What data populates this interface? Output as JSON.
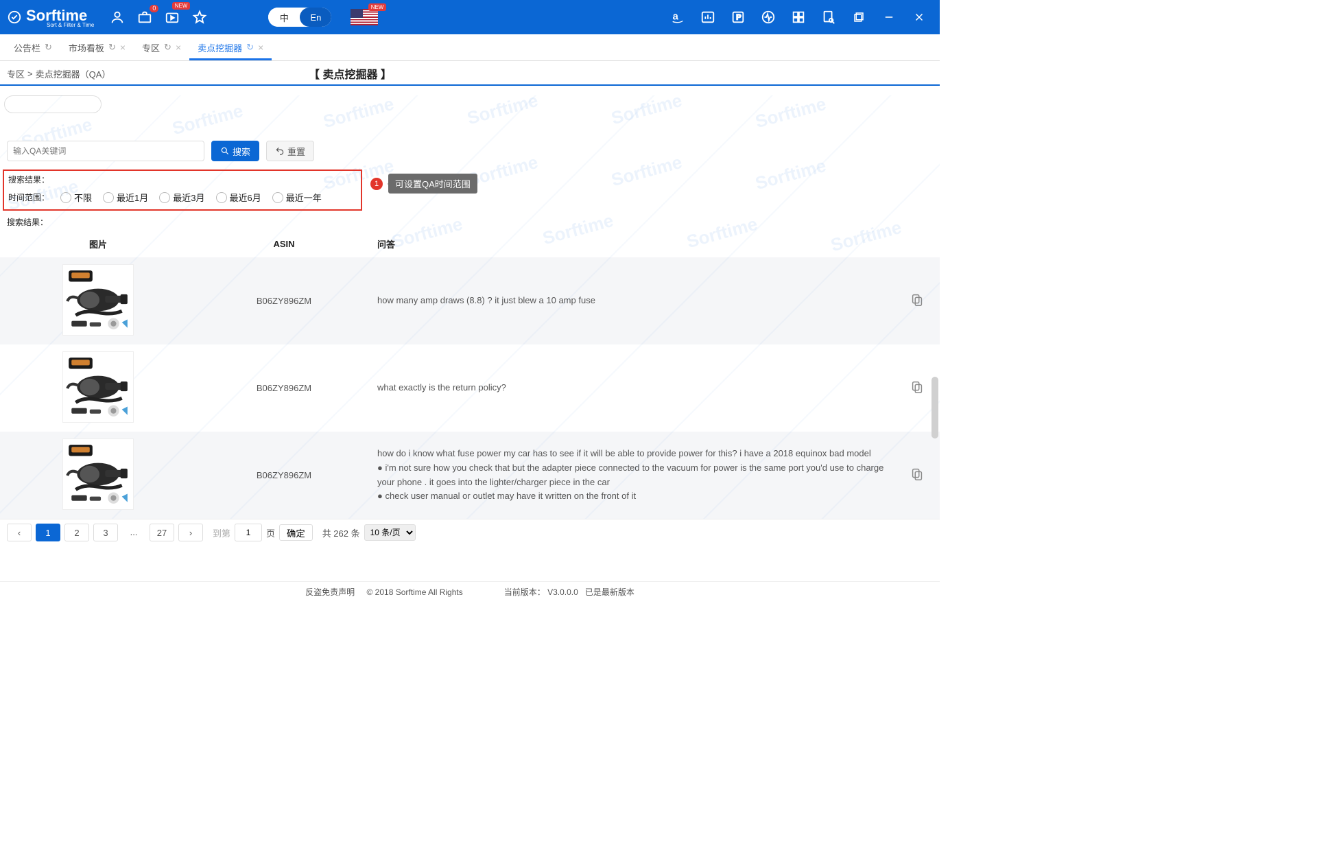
{
  "brand": {
    "name": "Sorftime",
    "tagline": "Sort & Filter & Time",
    "watermark": "Sorftime"
  },
  "topbar": {
    "cart_badge": "0",
    "new_badge": "NEW",
    "lang": {
      "zh": "中",
      "en": "En"
    }
  },
  "tabs": [
    {
      "label": "公告栏",
      "closable": false
    },
    {
      "label": "市场看板",
      "closable": true
    },
    {
      "label": "专区",
      "closable": true
    },
    {
      "label": "卖点挖掘器",
      "closable": true,
      "active": true
    }
  ],
  "breadcrumb": {
    "root": "专区",
    "sep": ">",
    "current": "卖点挖掘器（QA）"
  },
  "page_title": "【 卖点挖掘器 】",
  "search": {
    "placeholder": "输入QA关键词",
    "btn_search": "搜索",
    "btn_reset": "重置"
  },
  "filter": {
    "results_label": "搜索结果：",
    "time_label": "时间范围：",
    "options": [
      "不限",
      "最近1月",
      "最近3月",
      "最近6月",
      "最近一年"
    ]
  },
  "callout": {
    "num": "1",
    "text": "可设置QA时间范围"
  },
  "results_label2": "搜索结果：",
  "table": {
    "cols": {
      "img": "图片",
      "asin": "ASIN",
      "qa": "问答"
    },
    "rows": [
      {
        "asin": "B06ZY896ZM",
        "qa": "how many amp draws (8.8) ? it just blew a 10 amp fuse"
      },
      {
        "asin": "B06ZY896ZM",
        "qa": "what exactly is the return policy?"
      },
      {
        "asin": "B06ZY896ZM",
        "qa": "how do i know what fuse power my car has to see if it will be able to provide power for this? i have a 2018 equinox bad model\n● i'm not sure how you check that but the adapter piece connected to the vacuum for power is the same port you'd use to charge your phone . it goes into the lighter/charger piece in the car\n● check user manual or outlet may have it written on the front of it"
      }
    ]
  },
  "pager": {
    "pages": [
      "1",
      "2",
      "3",
      "...",
      "27"
    ],
    "current": "1",
    "goto_label": "到第",
    "goto_value": "1",
    "goto_unit": "页",
    "confirm": "确定",
    "total": "共 262 条",
    "per_page": "10 条/页"
  },
  "footer": {
    "disclaimer": "反盗免责声明",
    "copyright": "© 2018 Sorftime All Rights",
    "version_label": "当前版本：",
    "version_value": "V3.0.0.0",
    "version_latest": "已是最新版本"
  }
}
